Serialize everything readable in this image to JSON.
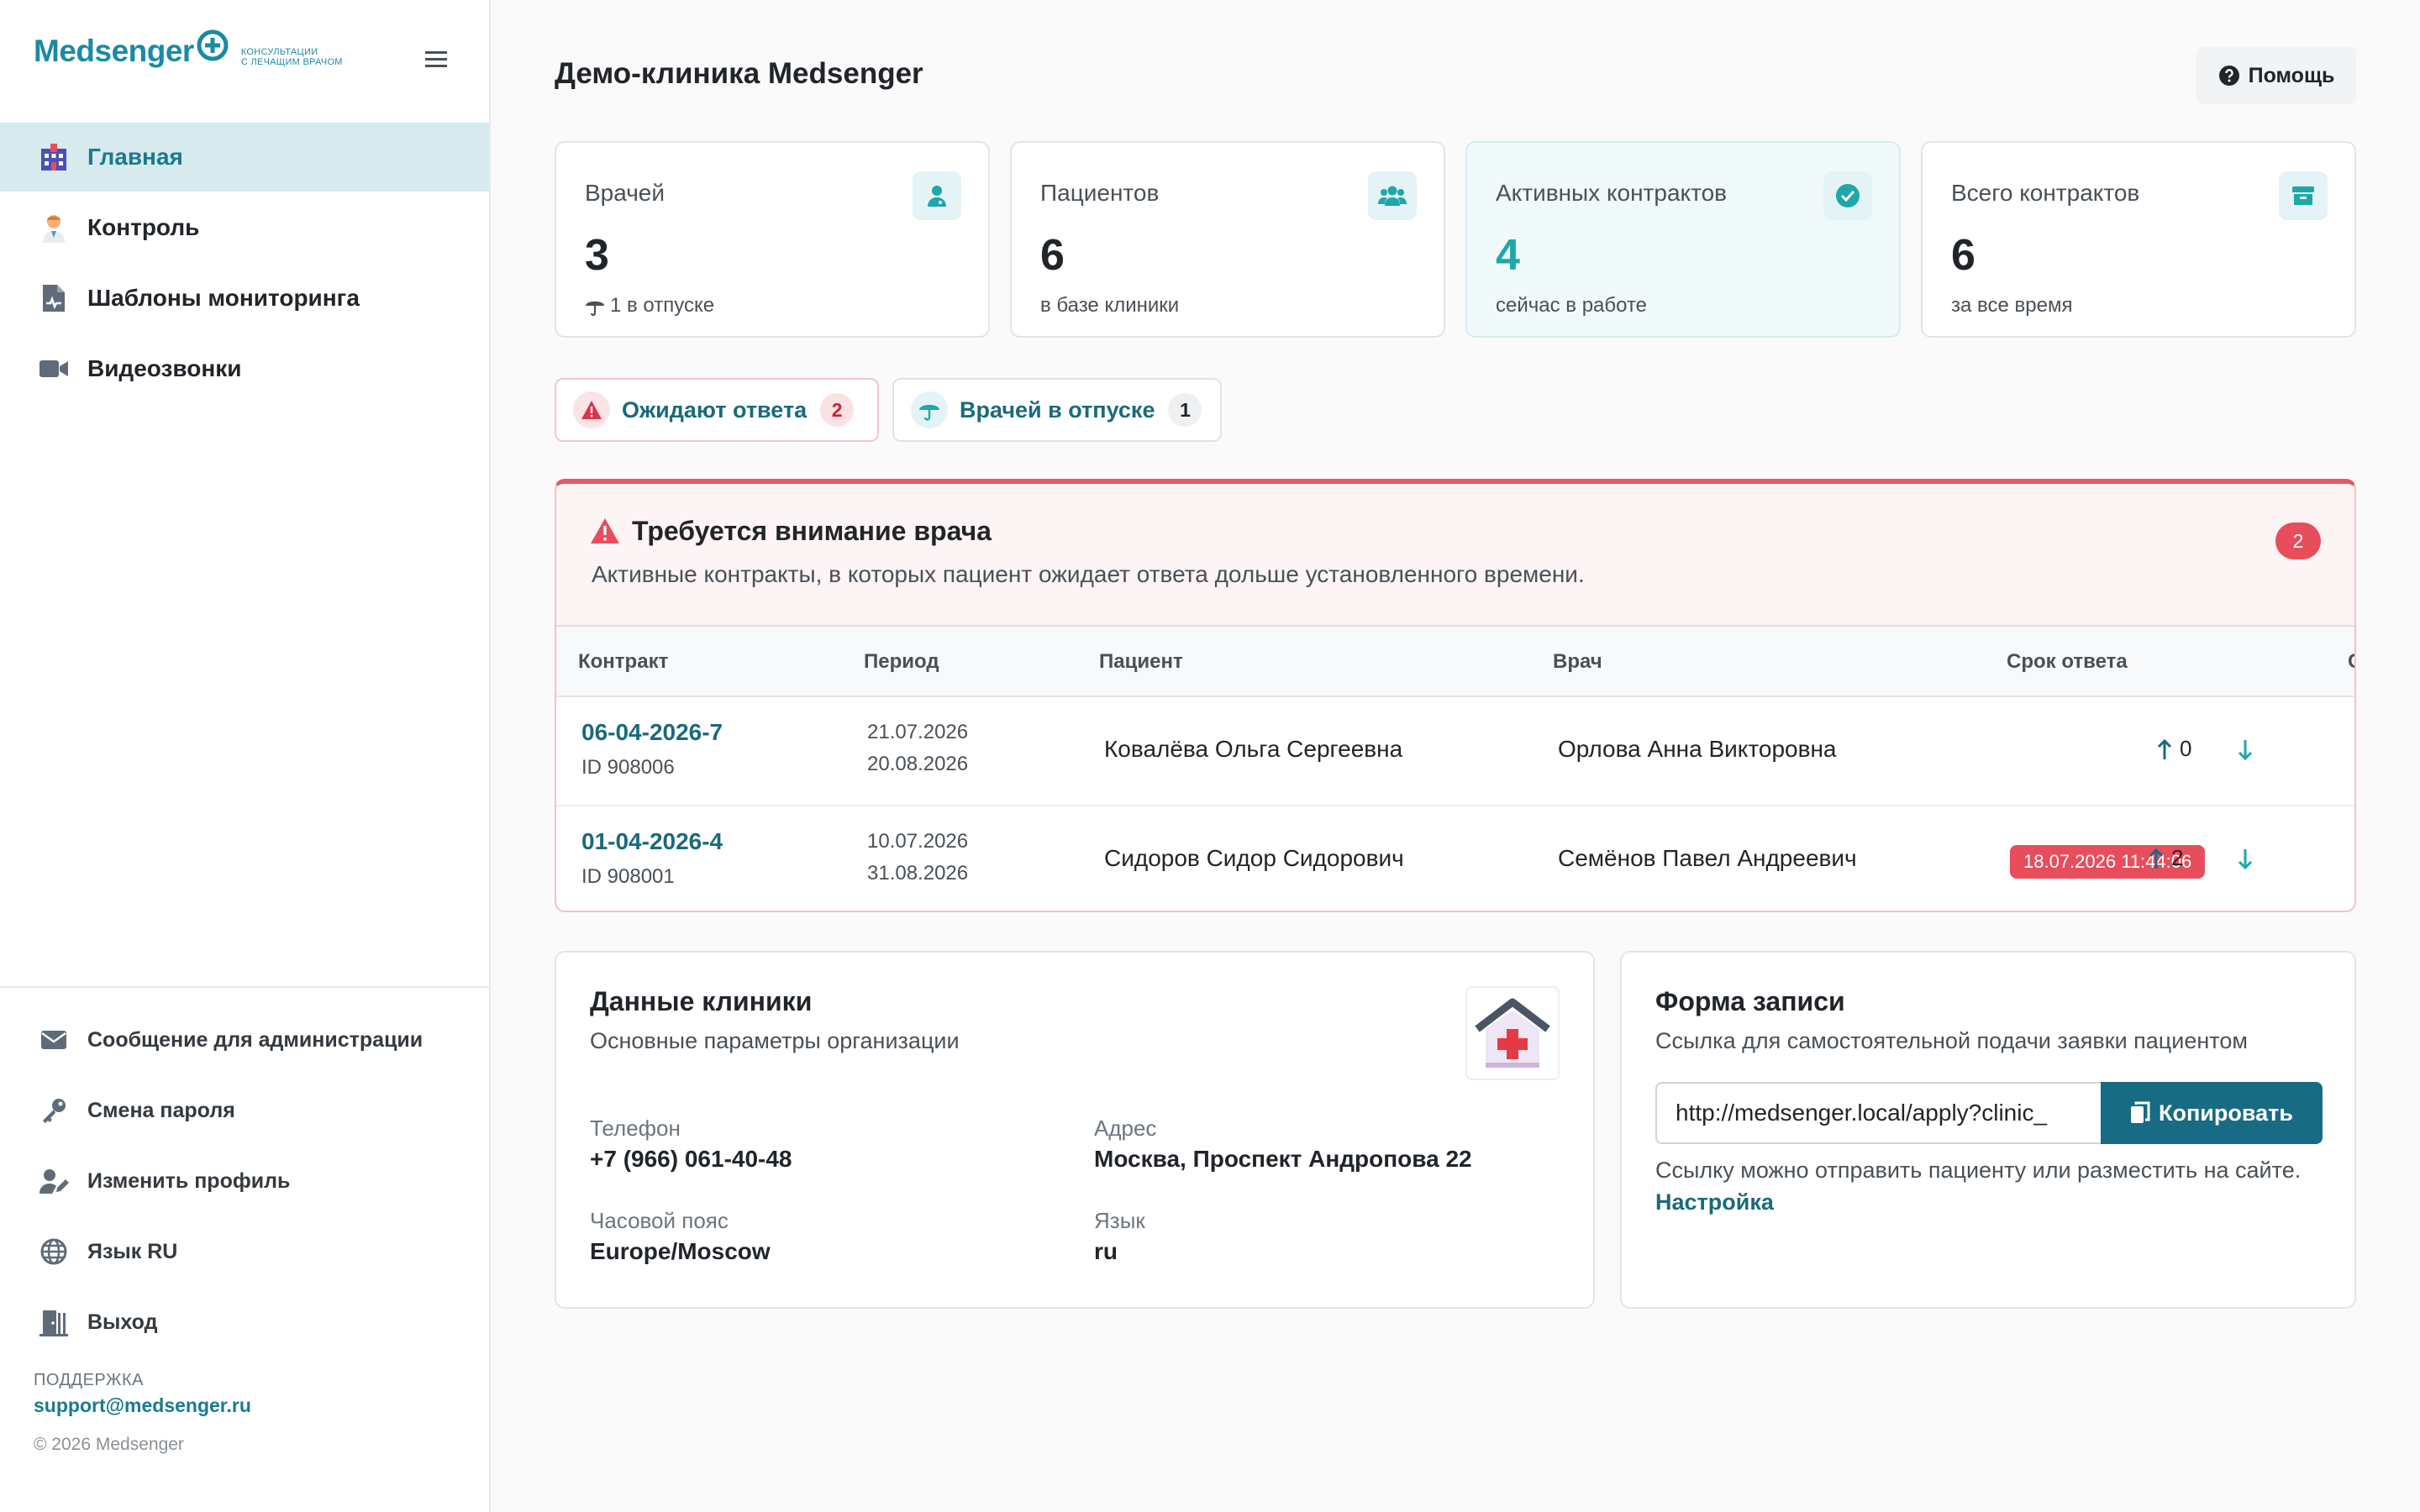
{
  "sidebar": {
    "logo": {
      "word": "Medsenger",
      "tagline_1": "консультации",
      "tagline_2": "с лечащим врачом"
    },
    "nav": [
      {
        "label": "Главная",
        "icon": "hospital-icon",
        "active": true
      },
      {
        "label": "Контроль",
        "icon": "doctor-icon"
      },
      {
        "label": "Шаблоны мониторинга",
        "icon": "file-medical-icon"
      },
      {
        "label": "Видеозвонки",
        "icon": "video-icon"
      }
    ],
    "bottom_nav": [
      {
        "label": "Сообщение для администрации",
        "icon": "envelope-icon"
      },
      {
        "label": "Смена пароля",
        "icon": "key-icon"
      },
      {
        "label": "Изменить профиль",
        "icon": "user-edit-icon"
      },
      {
        "label": "Язык RU",
        "icon": "globe-icon"
      },
      {
        "label": "Выход",
        "icon": "door-exit-icon"
      }
    ],
    "support_label": "ПОДДЕРЖКА",
    "support_email": "support@medsenger.ru",
    "copyright": "© 2026 Medsenger"
  },
  "header": {
    "title": "Демо-клиника Medsenger",
    "help_label": "Помощь"
  },
  "stats": [
    {
      "label": "Врачей",
      "value": "3",
      "sub": "1 в отпуске",
      "icon": "user-doctor-icon"
    },
    {
      "label": "Пациентов",
      "value": "6",
      "sub": "в базе клиники",
      "icon": "users-icon"
    },
    {
      "label": "Активных контрактов",
      "value": "4",
      "sub": "сейчас в работе",
      "icon": "check-circle-icon",
      "active": true
    },
    {
      "label": "Всего контрактов",
      "value": "6",
      "sub": "за все время",
      "icon": "archive-icon"
    }
  ],
  "chips": [
    {
      "label": "Ожидают ответа",
      "count": "2",
      "icon": "warning-icon"
    },
    {
      "label": "Врачей в отпуске",
      "count": "1",
      "icon": "umbrella-icon"
    }
  ],
  "alert": {
    "title": "Требуется внимание врача",
    "description": "Активные контракты, в которых пациент ожидает ответа дольше установленного времени.",
    "count": "2",
    "columns": [
      "Контракт",
      "Период",
      "Пациент",
      "Врач",
      "Срок ответа",
      "С"
    ],
    "rows": [
      {
        "contract": "06-04-2026-7",
        "id": "ID 908006",
        "period_start": "21.07.2026",
        "period_end": "20.08.2026",
        "patient": "Ковалёва Ольга Сергеевна",
        "doctor": "Орлова Анна Викторовна",
        "deadline": "",
        "up_count": "0"
      },
      {
        "contract": "01-04-2026-4",
        "id": "ID 908001",
        "period_start": "10.07.2026",
        "period_end": "31.08.2026",
        "patient": "Сидоров Сидор Сидорович",
        "doctor": "Семёнов Павел Андреевич",
        "deadline": "18.07.2026 11:44:06",
        "up_count": "2"
      }
    ]
  },
  "clinic": {
    "title": "Данные клиники",
    "subtitle": "Основные параметры организации",
    "phone_label": "Телефон",
    "phone": "+7 (966) 061-40-48",
    "address_label": "Адрес",
    "address": "Москва, Проспект Андропова 22",
    "tz_label": "Часовой пояс",
    "tz": "Europe/Moscow",
    "lang_label": "Язык",
    "lang": "ru"
  },
  "form": {
    "title": "Форма записи",
    "subtitle": "Ссылка для самостоятельной подачи заявки пациентом",
    "link": "http://medsenger.local/apply?clinic_",
    "copy_label": "Копировать",
    "note": "Ссылку можно отправить пациенту или разместить на сайте.",
    "settings_link": "Настройка"
  },
  "colors": {
    "accent": "#1a7a8e",
    "danger": "#e84d5c",
    "primary_button": "#176b82"
  }
}
